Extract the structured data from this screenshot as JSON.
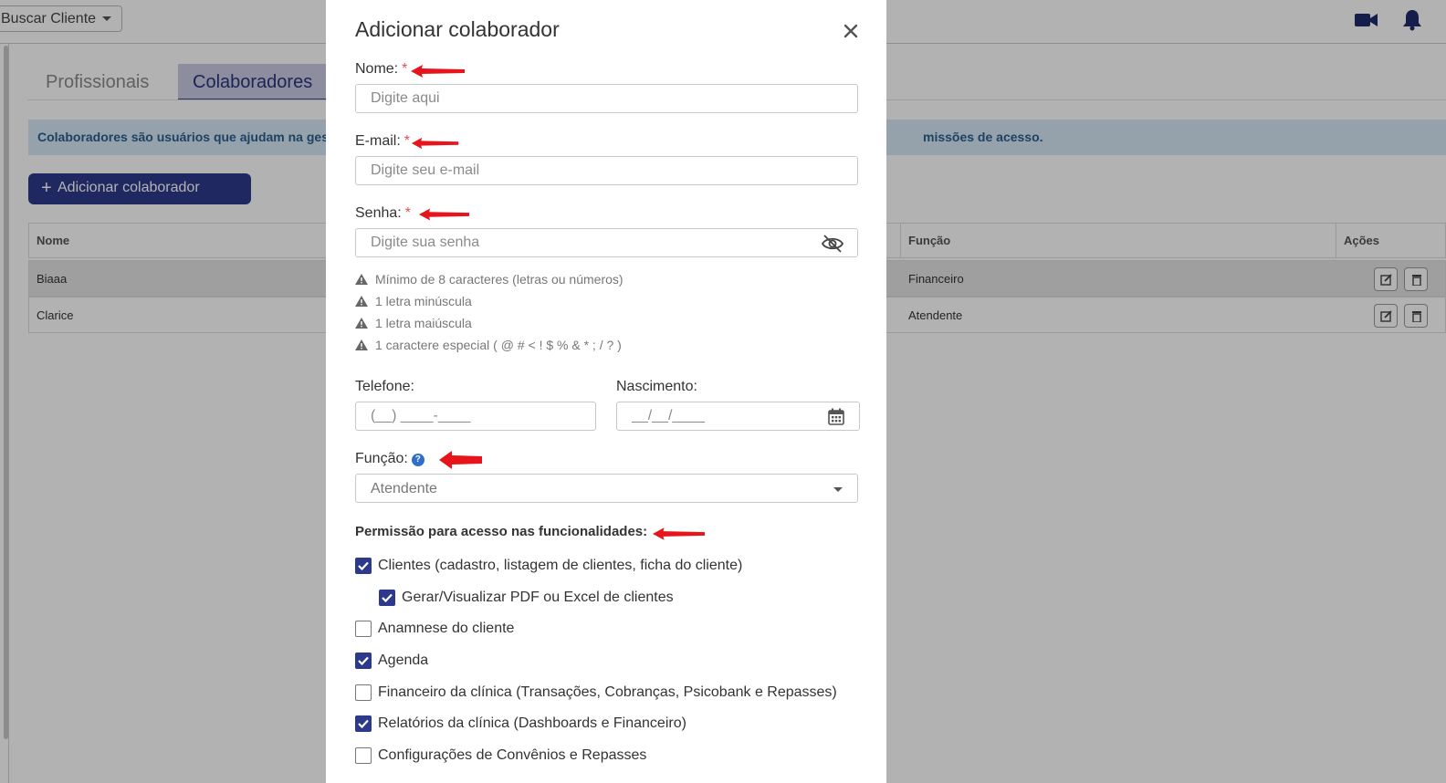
{
  "topbar": {
    "search_client_label": "Buscar Cliente",
    "icons": [
      "video-icon",
      "bell-icon"
    ]
  },
  "tabs": [
    {
      "label": "Profissionais",
      "active": false
    },
    {
      "label": "Colaboradores",
      "active": true
    }
  ],
  "info": {
    "text_left": "Colaboradores são usuários que ajudam na gestão",
    "text_right": "missões de acesso."
  },
  "add_button_label": "Adicionar colaborador",
  "table": {
    "headers": {
      "name": "Nome",
      "role": "Função",
      "actions": "Ações"
    },
    "rows": [
      {
        "name": "Biaaa",
        "role": "Financeiro"
      },
      {
        "name": "Clarice",
        "role": "Atendente"
      }
    ]
  },
  "modal": {
    "title": "Adicionar colaborador",
    "required_mark": "*",
    "name": {
      "label": "Nome:",
      "placeholder": "Digite aqui"
    },
    "email": {
      "label": "E-mail:",
      "placeholder": "Digite seu e-mail"
    },
    "password": {
      "label": "Senha:",
      "placeholder": "Digite sua senha"
    },
    "password_rules": [
      "Mínimo de 8 caracteres (letras ou números)",
      "1 letra minúscula",
      "1 letra maiúscula",
      "1 caractere especial ( @ # < ! $ % & * ; / ? )"
    ],
    "phone": {
      "label": "Telefone:",
      "placeholder": "(__) ____-____"
    },
    "birth": {
      "label": "Nascimento:",
      "placeholder": "__/__/____"
    },
    "role": {
      "label": "Função:",
      "help": "?",
      "value": "Atendente"
    },
    "permissions_title": "Permissão para acesso nas funcionalidades:",
    "permissions": [
      {
        "label": "Clientes (cadastro, listagem de clientes, ficha do cliente)",
        "checked": true,
        "indent": false
      },
      {
        "label": "Gerar/Visualizar PDF ou Excel de clientes",
        "checked": true,
        "indent": true
      },
      {
        "label": "Anamnese do cliente",
        "checked": false,
        "indent": false
      },
      {
        "label": "Agenda",
        "checked": true,
        "indent": false
      },
      {
        "label": "Financeiro da clínica (Transações, Cobranças, Psicobank e Repasses)",
        "checked": false,
        "indent": false
      },
      {
        "label": "Relatórios da clínica (Dashboards e Financeiro)",
        "checked": true,
        "indent": false
      },
      {
        "label": "Configurações de Convênios e Repasses",
        "checked": false,
        "indent": false
      }
    ]
  },
  "colors": {
    "primary": "#2d3a8c",
    "annotation_arrow": "#e8141c",
    "info_bg": "#d6e7f5",
    "required": "#d9534f"
  }
}
